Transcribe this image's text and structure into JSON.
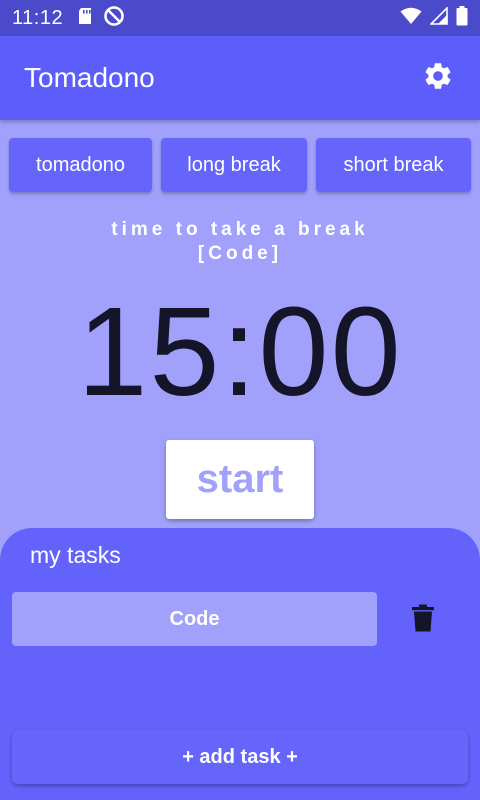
{
  "status_bar": {
    "time": "11:12",
    "icons": [
      "sd-card-icon",
      "no-disturb-icon",
      "wifi-icon",
      "signal-icon",
      "battery-icon"
    ]
  },
  "app_bar": {
    "title": "Tomadono",
    "settings_icon": "gear-icon"
  },
  "modes": [
    {
      "label": "tomadono"
    },
    {
      "label": "long break"
    },
    {
      "label": "short break"
    }
  ],
  "timer": {
    "message_line1": "time to take a break",
    "message_line2": "[Code]",
    "time": "15:00",
    "start_label": "start"
  },
  "tasks": {
    "heading": "my tasks",
    "items": [
      {
        "label": "Code"
      }
    ],
    "delete_icon": "trash-icon",
    "add_label": "+ add task +"
  },
  "colors": {
    "status_bar": "#4a4acb",
    "app_bar": "#5d5dfb",
    "background": "#a1a1fb",
    "panel": "#6363fb",
    "button": "#6565fb",
    "timer_text": "#15152a"
  }
}
